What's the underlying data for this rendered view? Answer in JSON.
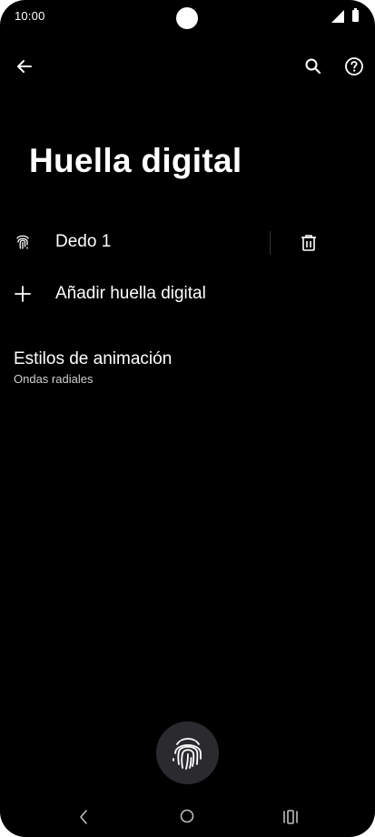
{
  "status_bar": {
    "time": "10:00"
  },
  "toolbar": {
    "back_icon": "arrow-back-icon",
    "search_icon": "search-icon",
    "help_icon": "help-icon"
  },
  "page": {
    "title": "Huella digital"
  },
  "fingerprints": [
    {
      "label": "Dedo 1",
      "icon": "fingerprint-icon",
      "action_icon": "trash-icon"
    }
  ],
  "add_fingerprint": {
    "label": "Añadir huella digital",
    "icon": "plus-icon"
  },
  "animation_style": {
    "title": "Estilos de animación",
    "value": "Ondas radiales"
  },
  "fingerprint_sensor": {
    "icon": "fingerprint-icon"
  },
  "navigation": {
    "back_icon": "nav-back-icon",
    "home_icon": "nav-home-icon",
    "recents_icon": "nav-recents-icon"
  },
  "colors": {
    "background": "#000000",
    "text": "#ffffff",
    "secondary_text": "#cfcfcf",
    "sensor_circle": "#2b2b2f"
  }
}
